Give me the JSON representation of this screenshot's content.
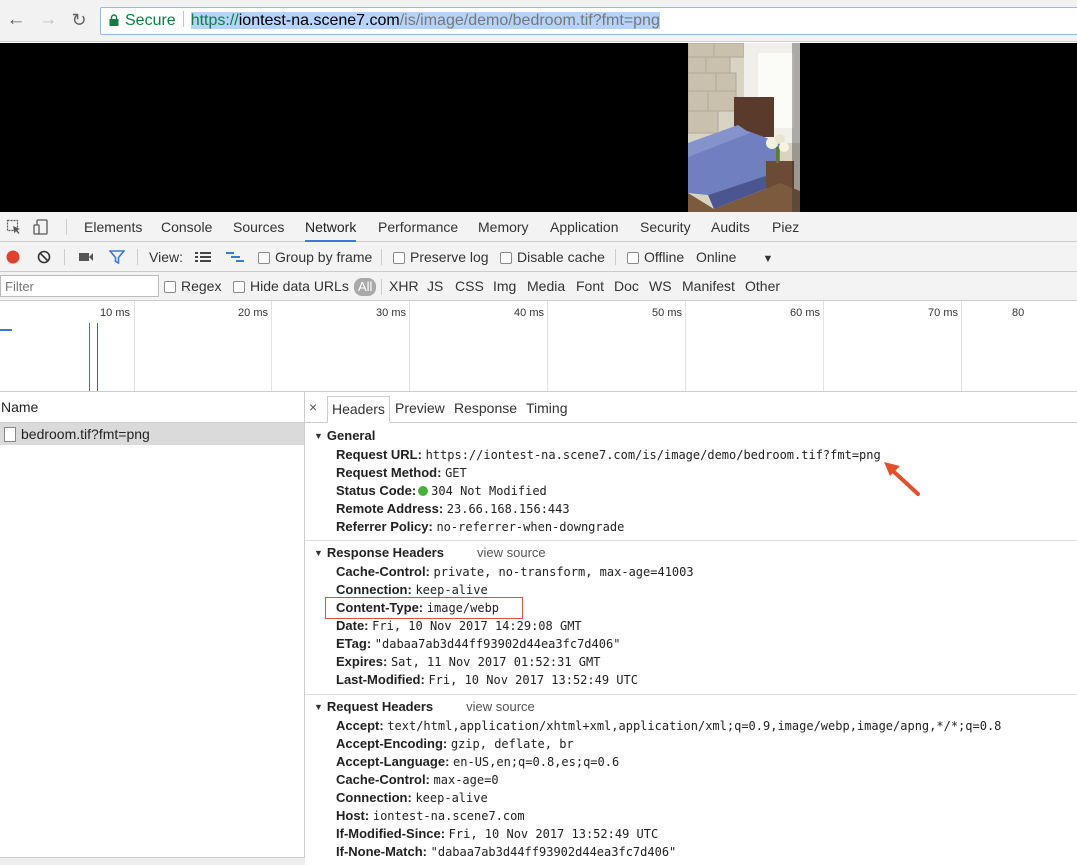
{
  "browser": {
    "secure_label": "Secure",
    "url_scheme": "https://",
    "url_host": "iontest-na.scene7.com",
    "url_path": "/is/image/demo/bedroom.tif?fmt=png"
  },
  "devtools": {
    "tabs": [
      "Elements",
      "Console",
      "Sources",
      "Network",
      "Performance",
      "Memory",
      "Application",
      "Security",
      "Audits",
      "Piez"
    ],
    "active_tab": "Network"
  },
  "net_toolbar": {
    "view_label": "View:",
    "group_by_frame": "Group by frame",
    "preserve_log": "Preserve log",
    "disable_cache": "Disable cache",
    "offline": "Offline",
    "throttle_value": "Online"
  },
  "filter_bar": {
    "placeholder": "Filter",
    "regex": "Regex",
    "hide_data_urls": "Hide data URLs",
    "all": "All",
    "types": [
      "XHR",
      "JS",
      "CSS",
      "Img",
      "Media",
      "Font",
      "Doc",
      "WS",
      "Manifest",
      "Other"
    ]
  },
  "overview": {
    "ticks": [
      "10 ms",
      "20 ms",
      "30 ms",
      "40 ms",
      "50 ms",
      "60 ms",
      "70 ms",
      "80"
    ]
  },
  "requests": {
    "name_header": "Name",
    "items": [
      "bedroom.tif?fmt=png"
    ]
  },
  "details": {
    "close": "×",
    "tabs": [
      "Headers",
      "Preview",
      "Response",
      "Timing"
    ],
    "active_tab": "Headers",
    "view_source": "view source",
    "general": {
      "title": "General",
      "rows": [
        {
          "k": "Request URL:",
          "v": "https://iontest-na.scene7.com/is/image/demo/bedroom.tif?fmt=png"
        },
        {
          "k": "Request Method:",
          "v": "GET"
        },
        {
          "k": "Status Code:",
          "v": "304 Not Modified"
        },
        {
          "k": "Remote Address:",
          "v": "23.66.168.156:443"
        },
        {
          "k": "Referrer Policy:",
          "v": "no-referrer-when-downgrade"
        }
      ]
    },
    "response_headers": {
      "title": "Response Headers",
      "rows": [
        {
          "k": "Cache-Control:",
          "v": "private, no-transform, max-age=41003"
        },
        {
          "k": "Connection:",
          "v": "keep-alive"
        },
        {
          "k": "Content-Type:",
          "v": "image/webp"
        },
        {
          "k": "Date:",
          "v": "Fri, 10 Nov 2017 14:29:08 GMT"
        },
        {
          "k": "ETag:",
          "v": "\"dabaa7ab3d44ff93902d44ea3fc7d406\""
        },
        {
          "k": "Expires:",
          "v": "Sat, 11 Nov 2017 01:52:31 GMT"
        },
        {
          "k": "Last-Modified:",
          "v": "Fri, 10 Nov 2017 13:52:49 UTC"
        }
      ]
    },
    "request_headers": {
      "title": "Request Headers",
      "rows": [
        {
          "k": "Accept:",
          "v": "text/html,application/xhtml+xml,application/xml;q=0.9,image/webp,image/apng,*/*;q=0.8"
        },
        {
          "k": "Accept-Encoding:",
          "v": "gzip, deflate, br"
        },
        {
          "k": "Accept-Language:",
          "v": "en-US,en;q=0.8,es;q=0.6"
        },
        {
          "k": "Cache-Control:",
          "v": "max-age=0"
        },
        {
          "k": "Connection:",
          "v": "keep-alive"
        },
        {
          "k": "Host:",
          "v": "iontest-na.scene7.com"
        },
        {
          "k": "If-Modified-Since:",
          "v": "Fri, 10 Nov 2017 13:52:49 UTC"
        },
        {
          "k": "If-None-Match:",
          "v": "\"dabaa7ab3d44ff93902d44ea3fc7d406\""
        }
      ]
    }
  },
  "colors": {
    "accent_blue": "#3879d9",
    "highlight_orange": "#e3502b",
    "status_green": "#4caf3a",
    "record_red": "#e0412f"
  }
}
